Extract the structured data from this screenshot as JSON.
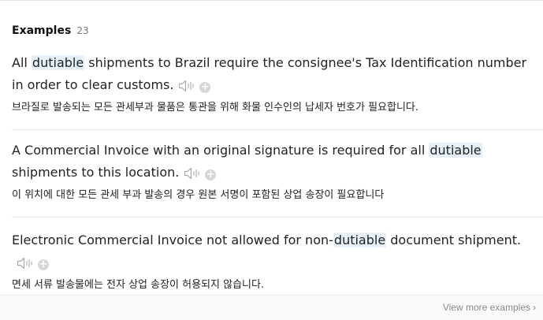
{
  "header": {
    "title": "Examples",
    "count": "23"
  },
  "examples": [
    {
      "en_before": "All ",
      "en_highlight": "dutiable",
      "en_after": " shipments to Brazil require the consignee's Tax Identification number in order to clear customs.",
      "ko": "브라질로 발송되는 모든 관세부과 물품은 통관을 위해 화물 인수인의 납세자 번호가 필요합니다."
    },
    {
      "en_before": "A Commercial Invoice with an original signature is required for all ",
      "en_highlight": "dutiable",
      "en_after": " shipments to this location.",
      "ko": "이 위치에 대한 모든 관세 부과 발송의 경우 원본 서명이 포함된 상업 송장이 필요합니다"
    },
    {
      "en_before": "Electronic Commercial Invoice not allowed for non-",
      "en_highlight": "dutiable",
      "en_after": " document shipment.",
      "ko": "면세 서류 발송물에는 전자 상업 송장이 허용되지 않습니다."
    }
  ],
  "icons": {
    "audio": "speaker-icon",
    "add": "plus-circle-icon",
    "more": "chevron-right-icon"
  },
  "add_glyph": "+",
  "footer": {
    "view_more_label": "View more examples",
    "chevron": "›"
  },
  "colors": {
    "highlight": "#e6f0fb",
    "icon_gray": "#b0b0b0",
    "footer_text": "#888888"
  }
}
